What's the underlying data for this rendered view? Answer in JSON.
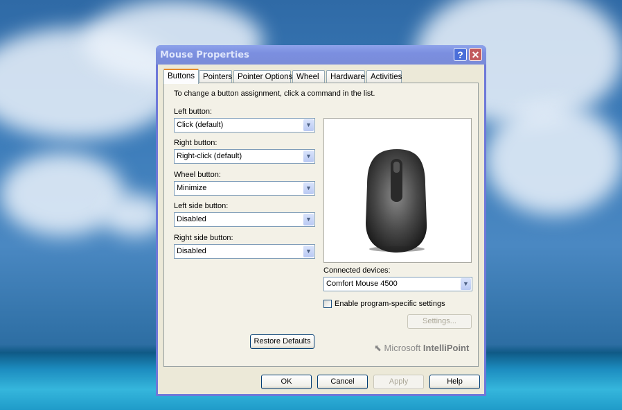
{
  "window": {
    "title": "Mouse Properties",
    "help_button": "?",
    "close_button": "✕"
  },
  "tabs": [
    {
      "label": "Buttons",
      "active": true
    },
    {
      "label": "Pointers",
      "active": false
    },
    {
      "label": "Pointer Options",
      "active": false
    },
    {
      "label": "Wheel",
      "active": false
    },
    {
      "label": "Hardware",
      "active": false
    },
    {
      "label": "Activities",
      "active": false
    }
  ],
  "buttons_tab": {
    "instruction": "To change a button assignment, click a command in the list.",
    "assignments": [
      {
        "label": "Left button:",
        "value": "Click (default)"
      },
      {
        "label": "Right button:",
        "value": "Right-click (default)"
      },
      {
        "label": "Wheel button:",
        "value": "Minimize"
      },
      {
        "label": "Left side button:",
        "value": "Disabled"
      },
      {
        "label": "Right side button:",
        "value": "Disabled"
      }
    ],
    "device_image": "mouse-image",
    "connected_devices_label": "Connected devices:",
    "connected_device_value": "Comfort Mouse 4500",
    "program_specific_label": "Enable program-specific settings",
    "program_specific_checked": false,
    "settings_button": "Settings...",
    "restore_defaults_button": "Restore Defaults",
    "brand_prefix": "Microsoft",
    "brand_name": "IntelliPoint"
  },
  "footer": {
    "ok": "OK",
    "cancel": "Cancel",
    "apply": "Apply",
    "help": "Help"
  },
  "icons": {
    "dropdown_arrow": "⌄",
    "cursor": "cursor-arrow-icon"
  }
}
